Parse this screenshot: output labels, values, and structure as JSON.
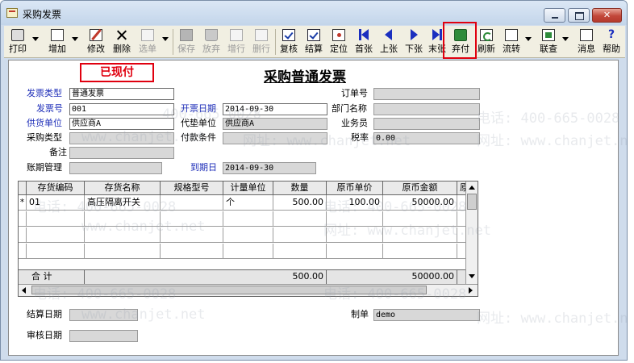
{
  "window": {
    "title": "采购发票",
    "close_glyph": "✕"
  },
  "toolbar": {
    "print": "打印",
    "add": "增加",
    "edit": "修改",
    "delete": "删除",
    "select": "选单",
    "save": "保存",
    "discard": "放弃",
    "add_row": "增行",
    "delete_row": "删行",
    "review": "复核",
    "settle": "结算",
    "locate": "定位",
    "first": "首张",
    "prev": "上张",
    "next": "下张",
    "last": "末张",
    "abandon_pay": "弃付",
    "refresh": "刷新",
    "flow": "流转",
    "link_query": "联查",
    "message": "消息",
    "help": "帮助",
    "help_glyph": "?"
  },
  "document": {
    "status_stamp": "已现付",
    "title": "采购普通发票",
    "labels": {
      "invoice_type": "发票类型",
      "invoice_no": "发票号",
      "supplier": "供货单位",
      "purchase_type": "采购类型",
      "remark": "备注",
      "credit_mgmt": "账期管理",
      "invoice_date": "开票日期",
      "advance_unit": "代垫单位",
      "payment_terms": "付款条件",
      "due_date": "到期日",
      "order_no": "订单号",
      "department": "部门名称",
      "salesman": "业务员",
      "tax_rate": "税率",
      "settle_date": "结算日期",
      "maker": "制单",
      "audit_date": "审核日期"
    },
    "values": {
      "invoice_type": "普通发票",
      "invoice_no": "001",
      "supplier": "供应商A",
      "purchase_type": "",
      "remark": "",
      "credit_mgmt": "",
      "invoice_date": "2014-09-30",
      "advance_unit": "供应商A",
      "payment_terms": "",
      "due_date": "2014-09-30",
      "order_no": "",
      "department": "",
      "salesman": "",
      "tax_rate": "0.00",
      "settle_date": "",
      "maker": "demo",
      "audit_date": ""
    }
  },
  "grid": {
    "headers": [
      "存货编码",
      "存货名称",
      "规格型号",
      "计量单位",
      "数量",
      "原币单价",
      "原币金额",
      "原"
    ],
    "rows": [
      {
        "marker": "*",
        "code": "01",
        "name": "高压隔离开关",
        "spec": "",
        "unit": "个",
        "qty": "500.00",
        "price": "100.00",
        "amount": "50000.00"
      }
    ],
    "sum_label": "合 计",
    "sum_qty": "500.00",
    "sum_amount": "50000.00"
  },
  "watermark": {
    "phone": "电话: 400-665-0028",
    "site": "网址: www.chanjet.net",
    "phone_short": "400-665-0028",
    "site_short": "www.chanjet.net"
  },
  "colors": {
    "accent_red": "#e0000f",
    "label_blue": "#1d2db8",
    "nav_blue": "#1b2fbf"
  }
}
